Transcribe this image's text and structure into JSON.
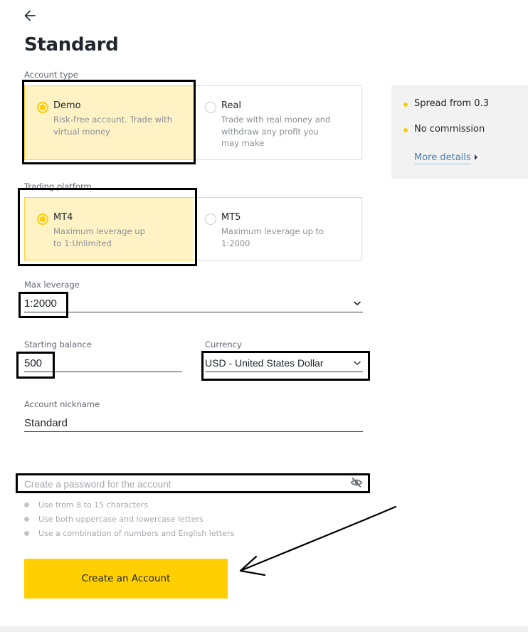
{
  "header": {
    "back_icon": "arrow-left-icon",
    "title": "Standard"
  },
  "account_type": {
    "label": "Account type",
    "options": [
      {
        "title": "Demo",
        "description": "Risk-free account. Trade with virtual money",
        "selected": true
      },
      {
        "title": "Real",
        "description": "Trade with real money and withdraw any profit you may make",
        "selected": false
      }
    ]
  },
  "info_panel": {
    "items": [
      "Spread from 0.3",
      "No commission"
    ],
    "more_link": "More details"
  },
  "trading_platform": {
    "label": "Trading platform",
    "options": [
      {
        "title": "MT4",
        "description": "Maximum leverage up to 1:Unlimited",
        "selected": true
      },
      {
        "title": "MT5",
        "description": "Maximum leverage up to 1:2000",
        "selected": false
      }
    ]
  },
  "max_leverage": {
    "label": "Max leverage",
    "value": "1:2000"
  },
  "starting_balance": {
    "label": "Starting balance",
    "value": "500"
  },
  "currency": {
    "label": "Currency",
    "value": "USD - United States Dollar"
  },
  "nickname": {
    "label": "Account nickname",
    "value": "Standard"
  },
  "password": {
    "placeholder": "Create a password for the account",
    "value": "",
    "toggle_icon": "eye-off-icon",
    "rules": [
      "Use from 8 to 15 characters",
      "Use both uppercase and lowercase letters",
      "Use a combination of numbers and English letters"
    ]
  },
  "submit": {
    "label": "Create an Account"
  },
  "colors": {
    "accent": "#ffcf01",
    "selected_card_bg": "#fff3c6",
    "link": "#4c7fb0"
  }
}
